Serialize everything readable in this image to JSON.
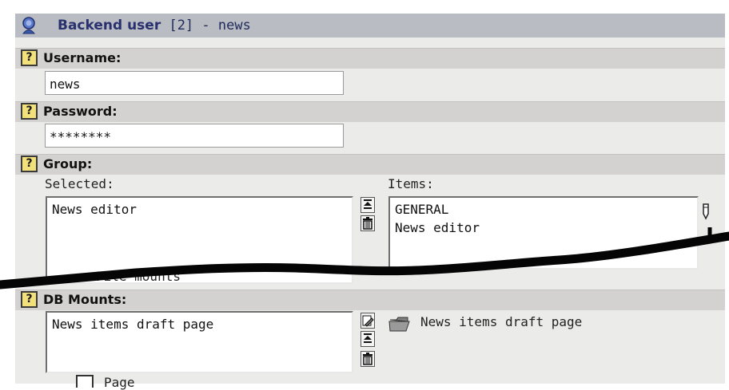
{
  "title": {
    "bold": "Backend user",
    "rest": " [2] - news"
  },
  "help_glyph": "?",
  "username": {
    "label": "Username:",
    "value": "news"
  },
  "password": {
    "label": "Password:",
    "value": "********"
  },
  "group": {
    "label": "Group:",
    "selected_label": "Selected:",
    "items_label": "Items:",
    "selected": [
      "News editor"
    ],
    "items": [
      "GENERAL",
      "News editor"
    ]
  },
  "obscured_text": "File mounts",
  "db_mounts": {
    "label": "DB Mounts:",
    "selected": [
      "News items draft page"
    ],
    "browse_item": "News items draft page"
  },
  "bottom_text": "Page",
  "colors": {
    "title_bg": "#b9bcc3",
    "header_bg": "#d4d2d0",
    "frame_bg": "#ebebe9"
  }
}
